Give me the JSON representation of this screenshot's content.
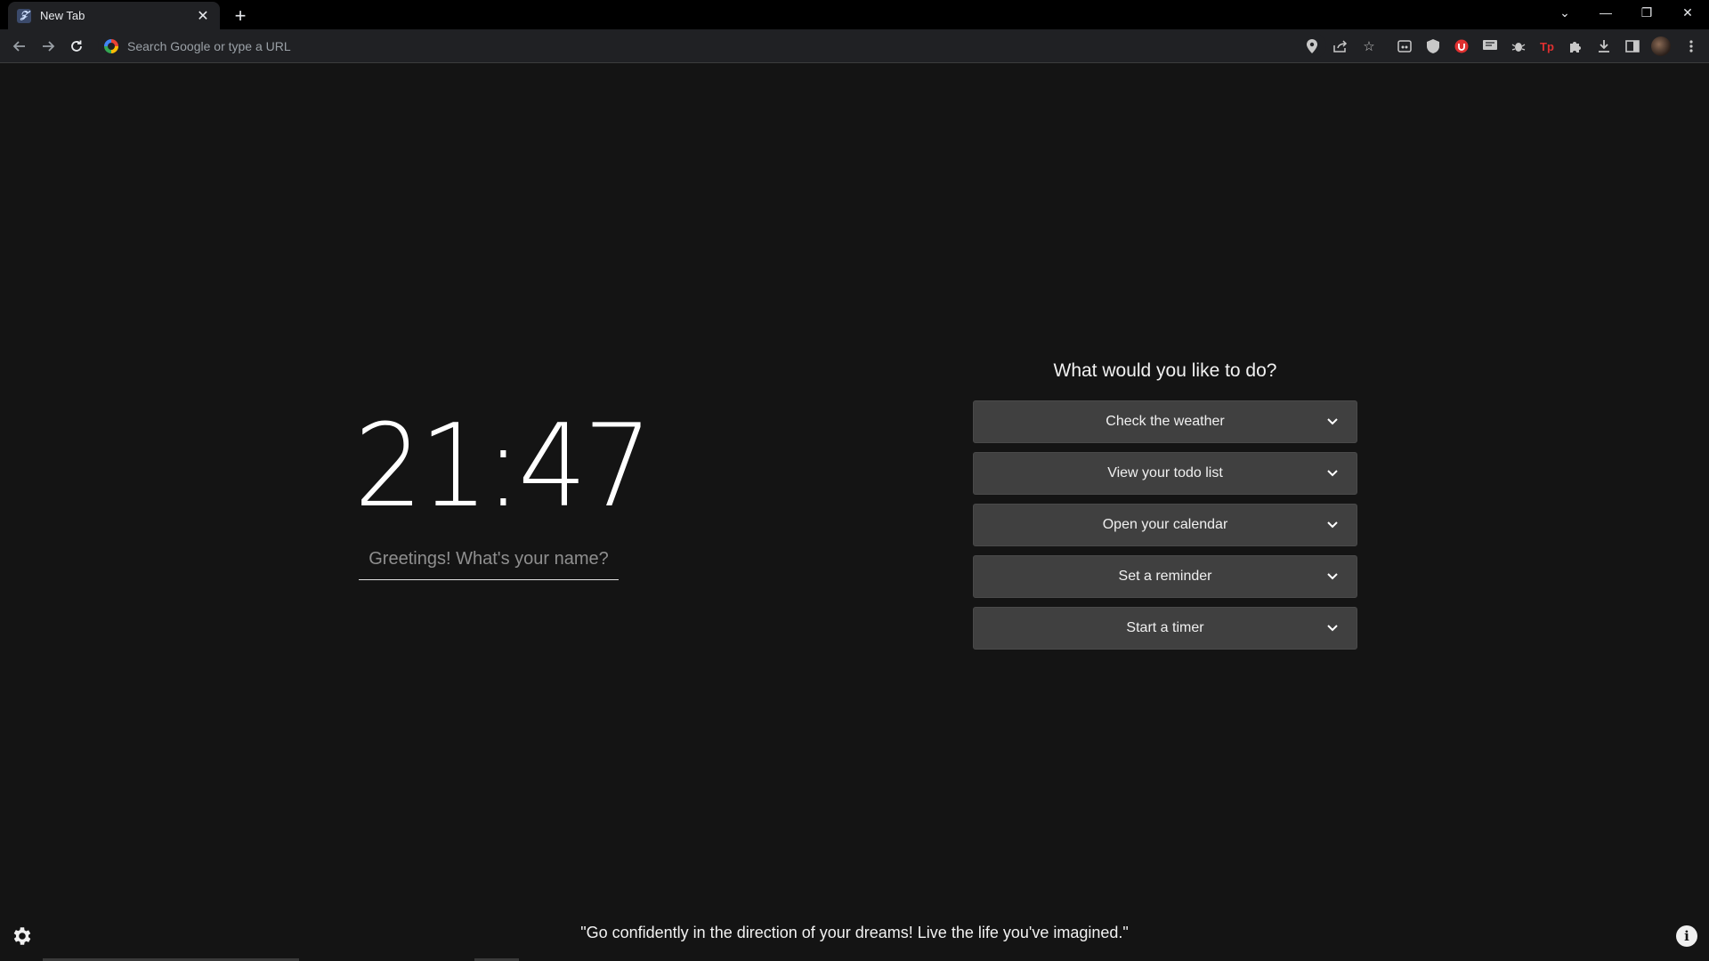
{
  "browser": {
    "tab": {
      "title": "New Tab",
      "favicon": "momentum-icon",
      "close_glyph": "✕"
    },
    "new_tab_glyph": "+",
    "window_controls": {
      "dropdown": "⌄",
      "minimize": "—",
      "restore": "❐",
      "close": "✕"
    },
    "omnibox": {
      "placeholder": "Search Google or type a URL",
      "value": ""
    },
    "toolbar_icons": [
      "location-icon",
      "share-icon",
      "bookmark-star-icon",
      "extension-icon",
      "shield-icon",
      "ublock-icon",
      "translate-icon",
      "bug-icon",
      "tp-icon",
      "puzzle-icon",
      "download-icon",
      "side-panel-icon",
      "profile-avatar",
      "menu-icon"
    ],
    "ext_tp_label": "Tp"
  },
  "main": {
    "clock": "21:47",
    "name_placeholder": "Greetings! What's your name?",
    "panel_title": "What would you like to do?",
    "actions": [
      "Check the weather",
      "View your todo list",
      "Open your calendar",
      "Set a reminder",
      "Start a timer"
    ],
    "quote": "\"Go confidently in the direction of your dreams! Live the life you've imagined.\"",
    "info_glyph": "i"
  },
  "colors": {
    "background": "#141414",
    "button_bg": "#404040",
    "chrome_bg": "#202124",
    "accent_red": "#e03030"
  }
}
